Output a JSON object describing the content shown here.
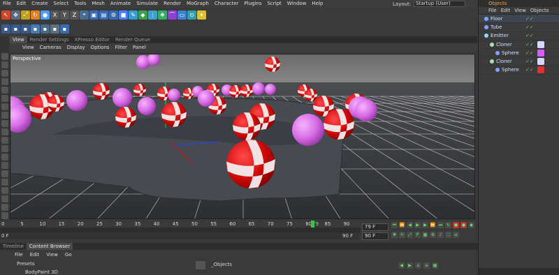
{
  "menubar": {
    "items": [
      "File",
      "Edit",
      "Create",
      "Select",
      "Tools",
      "Mesh",
      "Animate",
      "Simulate",
      "Render",
      "MoGraph",
      "Character",
      "Plugins",
      "Script",
      "Window",
      "Help"
    ],
    "layout_label": "Layout:",
    "layout_value": "Startup (User)"
  },
  "toolbar_top": {
    "tools": [
      "live-selection-icon",
      "move-icon",
      "scale-icon",
      "rotate-icon",
      "last-object-icon",
      "x-axis-icon",
      "y-axis-icon",
      "z-axis-icon",
      "coordinate-system-icon",
      "render-view-icon",
      "render-picture-viewer-icon",
      "render-settings-icon",
      "cube-icon",
      "pen-icon",
      "subdivision-icon",
      "array-icon",
      "cloner-icon",
      "deformer-icon",
      "floor-icon",
      "camera-icon",
      "light-icon"
    ]
  },
  "objects": {
    "title": "Objects",
    "menu": [
      "File",
      "Edit",
      "View",
      "Objects"
    ],
    "rows": [
      {
        "name": "Floor",
        "indent": 0,
        "icon_color": "#7aa8ff",
        "highlight": true
      },
      {
        "name": "Tube",
        "indent": 0,
        "icon_color": "#7aa8ff"
      },
      {
        "name": "Emitter",
        "indent": 0,
        "icon_color": "#9ad1ff"
      },
      {
        "name": "Cloner",
        "indent": 1,
        "icon_color": "#b0e0b0"
      },
      {
        "name": "Sphere",
        "indent": 2,
        "icon_color": "#7aa8ff"
      },
      {
        "name": "Cloner",
        "indent": 1,
        "icon_color": "#b0e0b0"
      },
      {
        "name": "Sphere",
        "indent": 2,
        "icon_color": "#7aa8ff"
      }
    ]
  },
  "viewport": {
    "tabs": [
      "View",
      "Render Settings",
      "XPresso Editor",
      "Render Queue"
    ],
    "active_tab": "View",
    "menu": [
      "View",
      "Cameras",
      "Display",
      "Options",
      "Filter",
      "Panel"
    ],
    "camera_label": "Perspective"
  },
  "timeline": {
    "ticks": [
      "0",
      "5",
      "10",
      "15",
      "20",
      "25",
      "30",
      "35",
      "40",
      "45",
      "50",
      "55",
      "60",
      "65",
      "70",
      "75",
      "80",
      "85",
      "90"
    ],
    "current_frame_label": "79",
    "start_frame": "0 F",
    "end_frame": "90 F",
    "frame_field_a": "79 F",
    "frame_field_b": "90 F"
  },
  "content_browser": {
    "tabs": [
      "Timeline",
      "Content Browser"
    ],
    "active_tab": "Content Browser",
    "menu": [
      "File",
      "Edit",
      "View",
      "Go"
    ],
    "tree_items": [
      "Presets",
      "BodyPaint 3D"
    ],
    "path_label": "_Objects"
  }
}
